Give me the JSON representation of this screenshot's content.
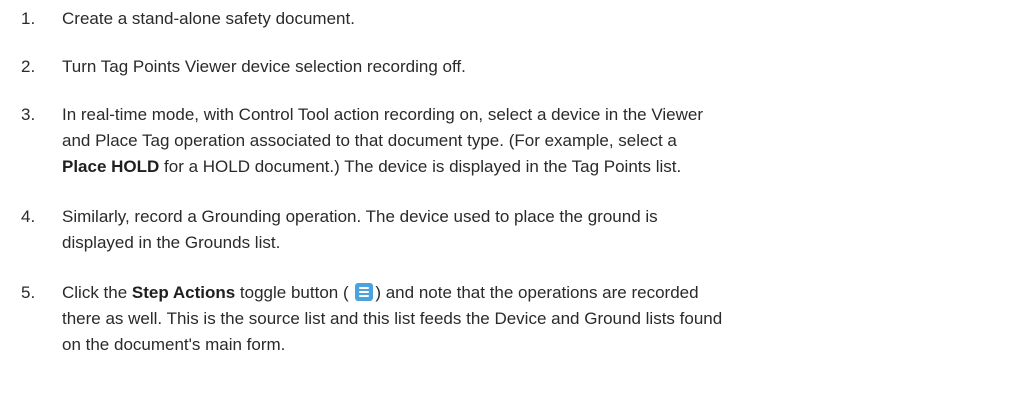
{
  "steps": [
    {
      "num": "1.",
      "text": "Create a stand-alone safety document."
    },
    {
      "num": "2.",
      "text": "Turn Tag Points Viewer device selection recording off."
    },
    {
      "num": "3.",
      "line1": "In real-time mode, with Control Tool action recording on, select a device in the Viewer",
      "line2": "and Place Tag operation associated to that document type. (For example, select a",
      "bold": "Place HOLD",
      "line3_rest": " for a HOLD document.) The device is displayed in the Tag Points list."
    },
    {
      "num": "4.",
      "line1": "Similarly, record a Grounding operation. The device used to place the ground is",
      "line2": "displayed in the Grounds list."
    },
    {
      "num": "5.",
      "pre": "Click the ",
      "bold": "Step Actions",
      "mid": " toggle button ( ",
      "post": ") and note that the operations are recorded",
      "line2": "there as well. This is the source list and this list feeds the Device and Ground lists found",
      "line3": "on the document's main form.",
      "icon": "list-icon",
      "icon_color": "#4aa3df"
    }
  ]
}
